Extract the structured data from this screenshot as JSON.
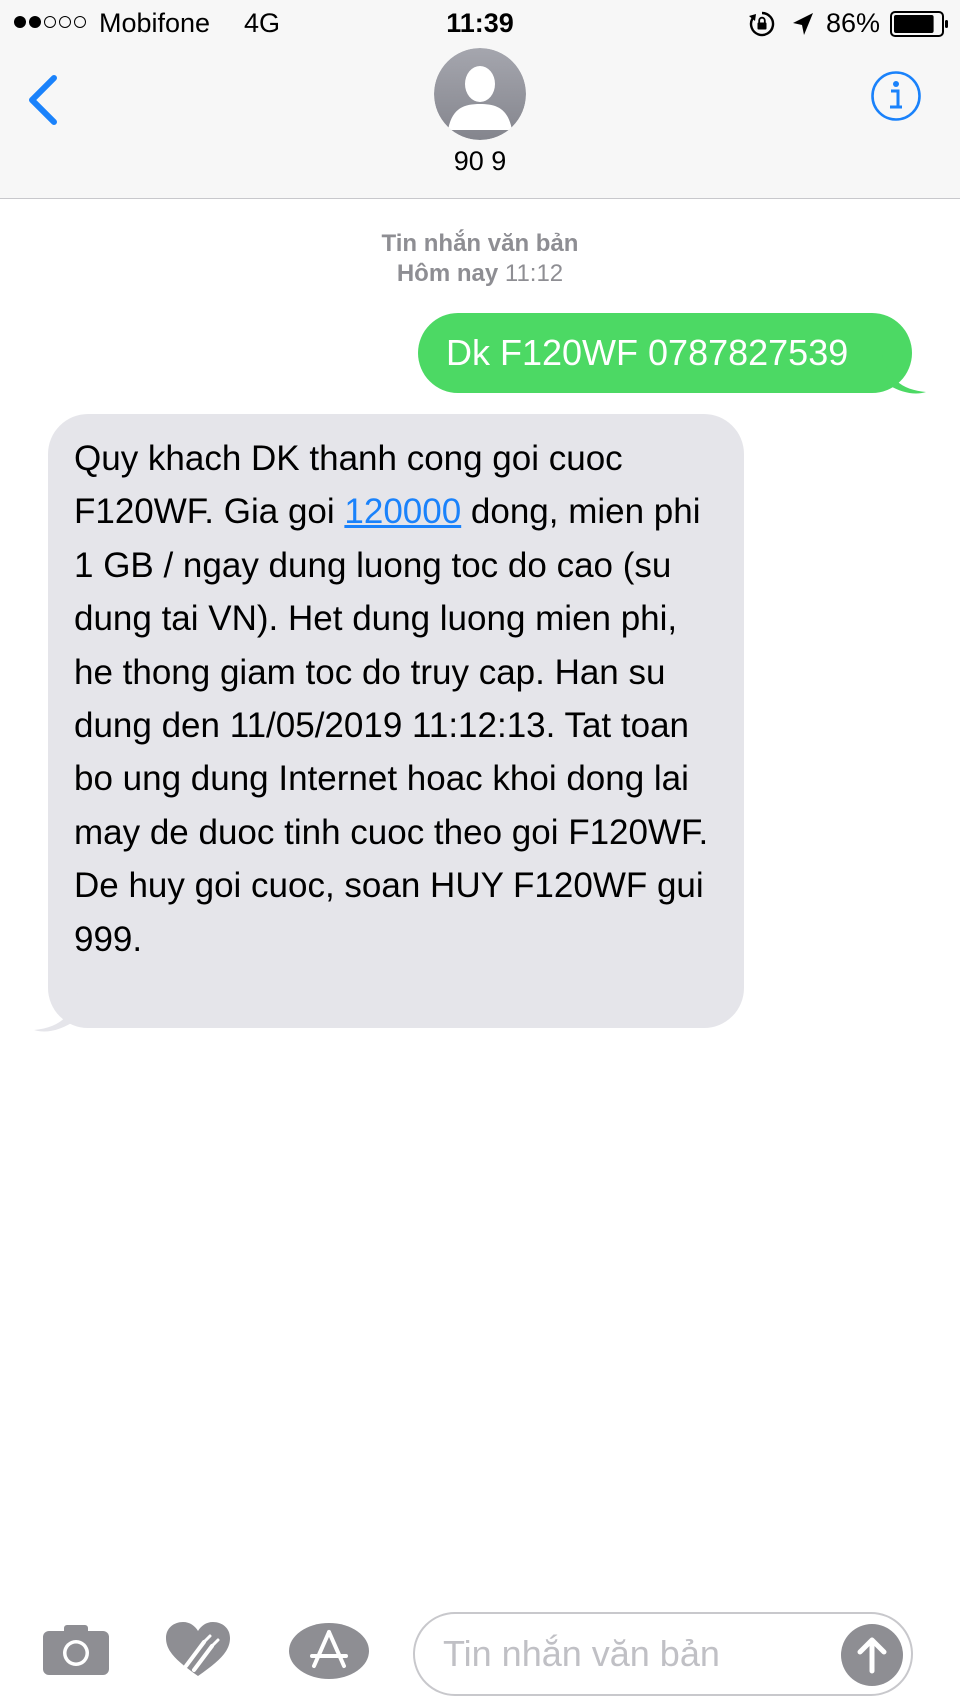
{
  "status_bar": {
    "signal_bars_filled": 2,
    "signal_bars_total": 5,
    "carrier": "Mobifone",
    "network": "4G",
    "time": "11:39",
    "battery_percent_label": "86%",
    "battery_level": 0.86,
    "icons": [
      "orientation-lock-icon",
      "location-arrow-icon",
      "battery-icon"
    ]
  },
  "header": {
    "back_icon": "chevron-left-icon",
    "avatar_icon": "person-silhouette-icon",
    "contact_name": "90 9",
    "info_icon": "info-icon"
  },
  "conversation": {
    "message_type": "Tin nhắn văn bản",
    "day_label": "Hôm nay",
    "time_label": "11:12",
    "outgoing": {
      "text": "Dk F120WF 0787827539"
    },
    "incoming": {
      "text_before_link": "Quy khach DK thanh cong goi cuoc F120WF. Gia goi ",
      "link_text": "120000",
      "text_after_link": " dong, mien phi 1 GB / ngay dung luong toc do cao (su dung tai VN). Het dung luong mien phi, he thong giam toc do truy cap. Han su dung den 11/05/2019 11:12:13. Tat toan bo ung dung Internet hoac khoi dong lai may de duoc tinh cuoc theo goi F120WF. De huy goi cuoc, soan HUY F120WF gui 999."
    }
  },
  "compose": {
    "camera_icon": "camera-icon",
    "digital_touch_icon": "heart-hands-icon",
    "app_store_icon": "app-store-icon",
    "placeholder": "Tin nhắn văn bản",
    "value": "",
    "send_icon": "send-arrow-up-icon"
  },
  "colors": {
    "accent": "#1a82fb",
    "outgoing_bubble": "#4cd964",
    "incoming_bubble": "#e5e5ea",
    "meta_text": "#8e8e93",
    "icon_gray": "#8e8e93"
  }
}
